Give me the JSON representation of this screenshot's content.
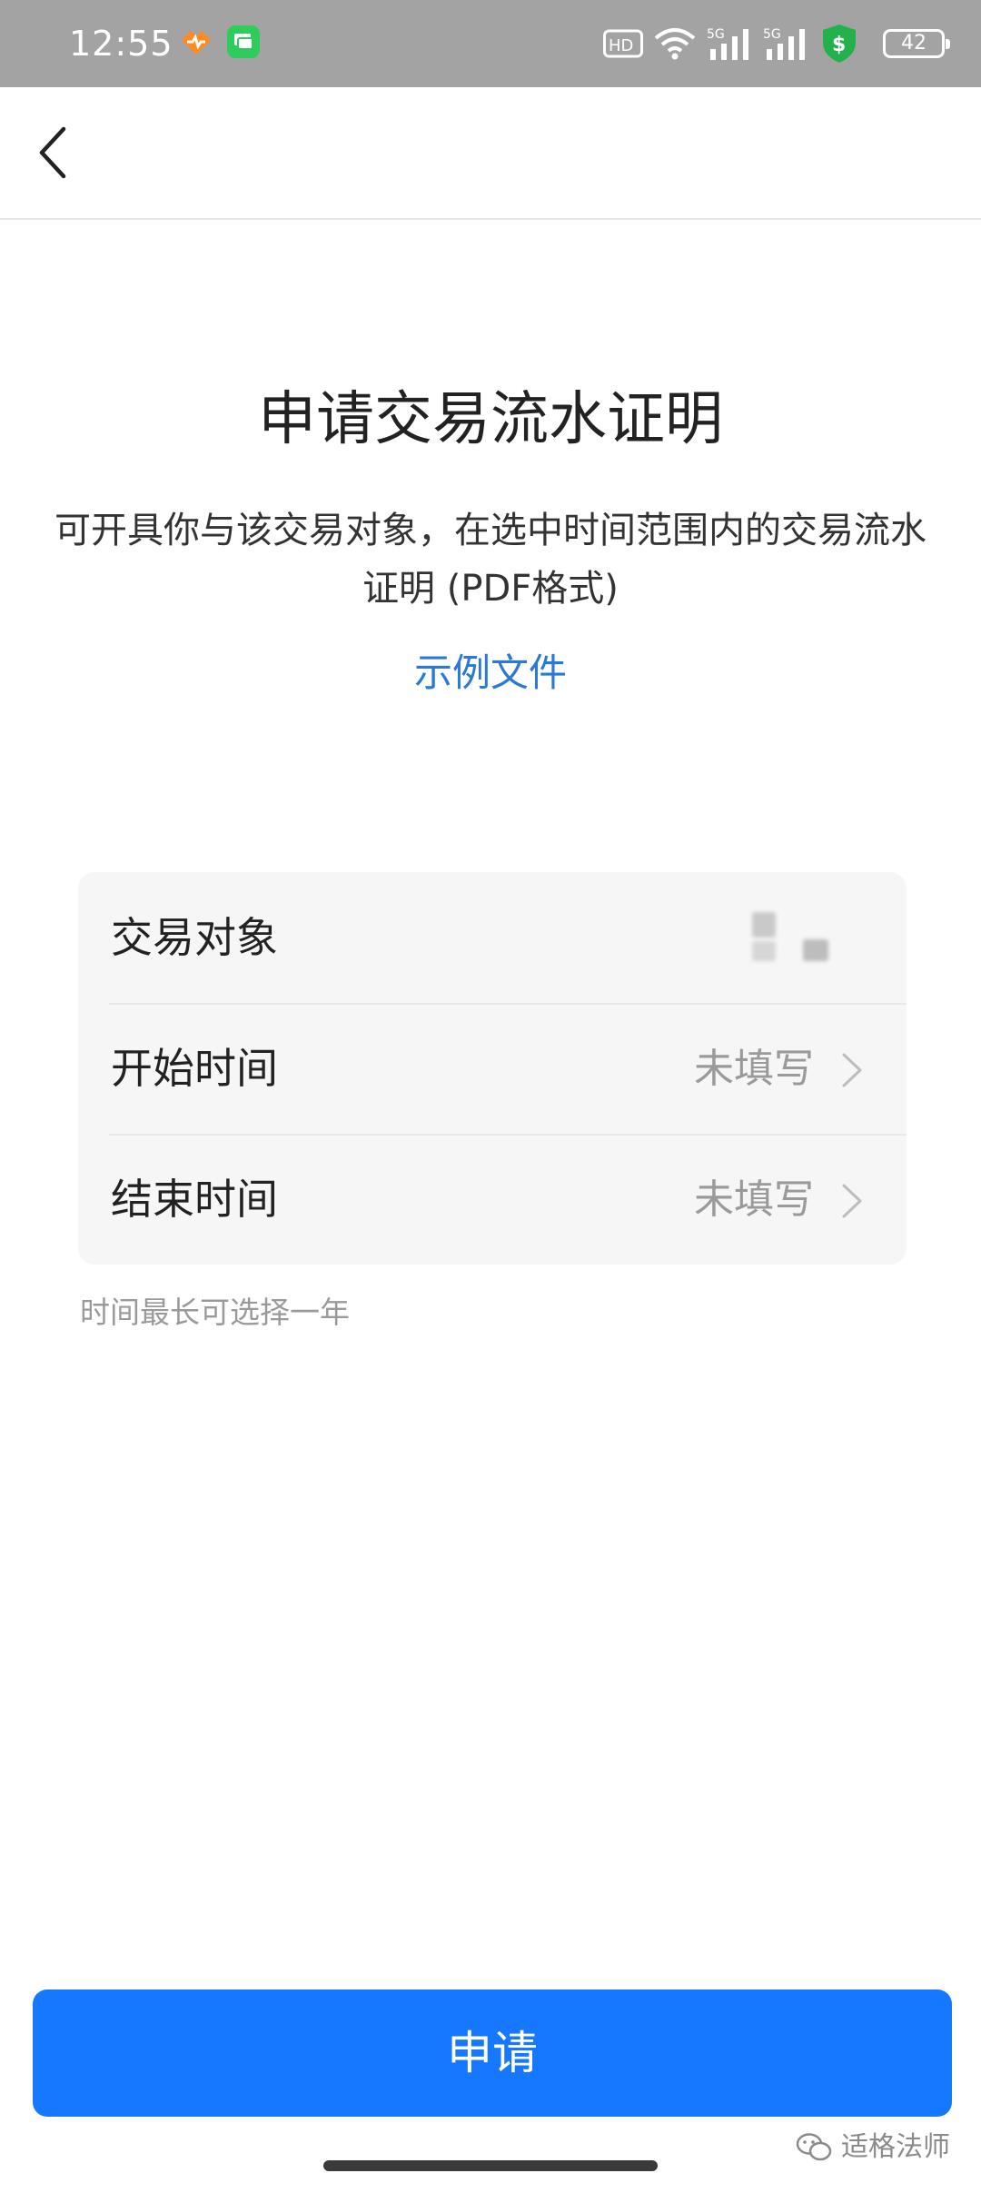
{
  "status_bar": {
    "time": "12:55",
    "icons": [
      "fitness-app-icon",
      "message-app-icon",
      "hd-voice-icon",
      "wifi-icon",
      "signal-5g-icon",
      "signal-5g-icon",
      "security-shield-icon",
      "battery-icon"
    ],
    "hd_label": "HD",
    "network_label_1": "5G",
    "network_label_2": "5G",
    "battery_level": "42",
    "colors": {
      "background": "#a3a3a3",
      "shield": "#22b14c",
      "fitness": "#ff8a1f",
      "message": "#2ecc5b"
    }
  },
  "nav": {
    "back_icon": "chevron-left-icon"
  },
  "header": {
    "title": "申请交易流水证明",
    "description": "可开具你与该交易对象，在选中时间范围内的交易流水证明 (PDF格式)",
    "sample_link": "示例文件"
  },
  "form": {
    "rows": [
      {
        "label": "交易对象",
        "value": "",
        "chevron": false
      },
      {
        "label": "开始时间",
        "value": "未填写",
        "chevron": true
      },
      {
        "label": "结束时间",
        "value": "未填写",
        "chevron": true
      }
    ],
    "hint": "时间最长可选择一年"
  },
  "submit": {
    "label": "申请",
    "color": "#1677ff"
  },
  "watermark": {
    "text": "适格法师",
    "icon": "wechat-icon"
  },
  "colors": {
    "link": "#2a78d9",
    "placeholder": "#9a9a9a"
  }
}
